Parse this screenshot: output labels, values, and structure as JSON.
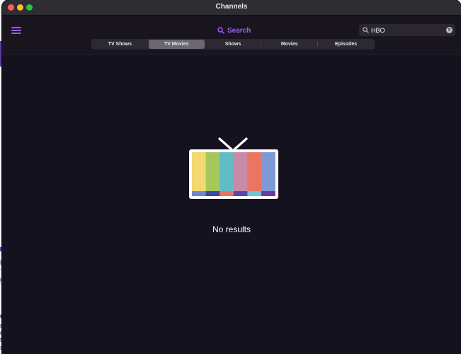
{
  "window": {
    "title": "Channels"
  },
  "header": {
    "search_label": "Search",
    "search_value": "HBO",
    "clear_glyph": "×"
  },
  "tabs": [
    {
      "label": "TV Shows",
      "active": false
    },
    {
      "label": "TV Movies",
      "active": true
    },
    {
      "label": "Shows",
      "active": false
    },
    {
      "label": "Movies",
      "active": false
    },
    {
      "label": "Episodes",
      "active": false
    }
  ],
  "empty_state": {
    "message": "No results",
    "icon": "tv-color-bars-icon"
  },
  "background_fragments": [
    "Fo",
    "ni",
    "C",
    "ne",
    "d",
    "t",
    "sh"
  ],
  "colors": {
    "accent": "#a259ff",
    "window_bg": "#15121f",
    "bar_colors": [
      "#f1d871",
      "#a6c75c",
      "#60bcc6",
      "#c989a8",
      "#e97562",
      "#7f99d6"
    ],
    "bottom_bar_colors": [
      "#6f86d2",
      "#3e48a0",
      "#e97562",
      "#5b45a8",
      "#6fc4d0",
      "#6a3aa0"
    ]
  }
}
